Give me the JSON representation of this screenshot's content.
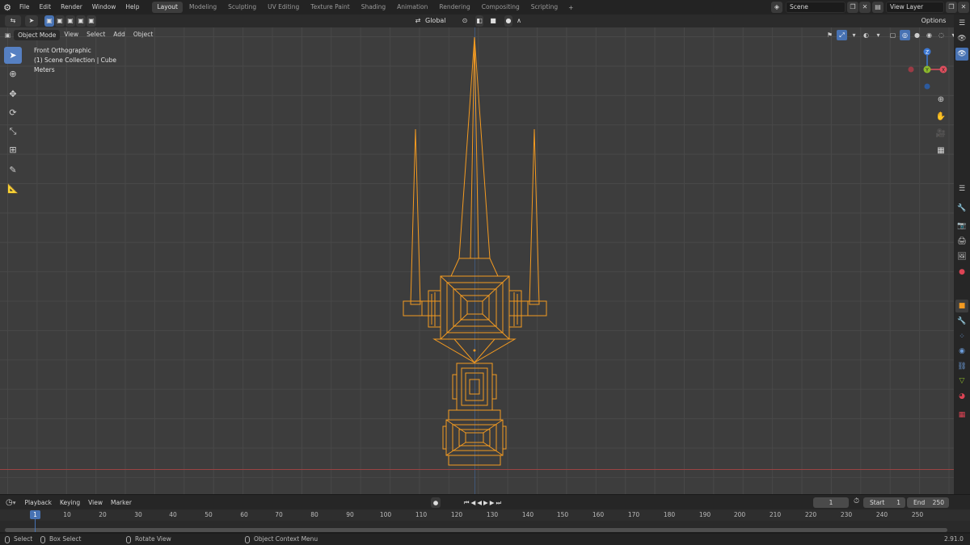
{
  "topbar": {
    "menus": [
      "File",
      "Edit",
      "Render",
      "Window",
      "Help"
    ],
    "tabs": [
      "Layout",
      "Modeling",
      "Sculpting",
      "UV Editing",
      "Texture Paint",
      "Shading",
      "Animation",
      "Rendering",
      "Compositing",
      "Scripting"
    ],
    "active_tab": "Layout",
    "add_tab": "+",
    "scene": "Scene",
    "view_layer": "View Layer"
  },
  "toolheader": {
    "orientation": "Global",
    "options": "Options"
  },
  "viewport": {
    "mode": "Object Mode",
    "menus": [
      "View",
      "Select",
      "Add",
      "Object"
    ],
    "view_name": "Front Orthographic",
    "collection": "(1) Scene Collection | Cube",
    "units": "Meters",
    "gizmo": {
      "z": "Z",
      "y": "Y",
      "x": "X"
    },
    "colors": {
      "x_axis": "#e04f5e",
      "y_axis": "#8cb92c",
      "z_axis": "#3d78d4",
      "selection": "#f39a21"
    }
  },
  "timeline": {
    "menus": [
      "Playback",
      "Keying",
      "View",
      "Marker"
    ],
    "current_frame": "1",
    "start_label": "Start",
    "start": "1",
    "end_label": "End",
    "end": "250",
    "playhead": "1",
    "ticks": [
      "10",
      "20",
      "30",
      "40",
      "50",
      "60",
      "70",
      "80",
      "90",
      "100",
      "110",
      "120",
      "130",
      "140",
      "150",
      "160",
      "170",
      "180",
      "190",
      "200",
      "210",
      "220",
      "230",
      "240",
      "250"
    ]
  },
  "statusbar": {
    "select": "Select",
    "box_select": "Box Select",
    "rotate_view": "Rotate View",
    "context_menu": "Object Context Menu",
    "version": "2.91.0"
  }
}
